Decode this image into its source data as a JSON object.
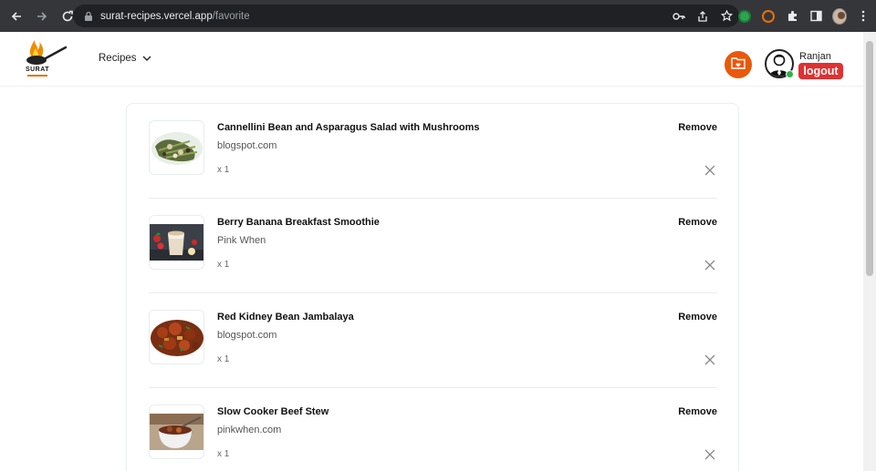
{
  "browser": {
    "url_host": "surat-recipes.vercel.app",
    "url_path": "/favorite"
  },
  "header": {
    "logo_text": "SURAT",
    "nav_label": "Recipes",
    "user_name": "Ranjan",
    "logout_label": "logout"
  },
  "favorites": [
    {
      "title": "Cannellini Bean and Asparagus Salad with Mushrooms",
      "source": "blogspot.com",
      "qty": "x 1",
      "remove_label": "Remove"
    },
    {
      "title": "Berry Banana Breakfast Smoothie",
      "source": "Pink When",
      "qty": "x 1",
      "remove_label": "Remove"
    },
    {
      "title": "Red Kidney Bean Jambalaya",
      "source": "blogspot.com",
      "qty": "x 1",
      "remove_label": "Remove"
    },
    {
      "title": "Slow Cooker Beef Stew",
      "source": "pinkwhen.com",
      "qty": "x 1",
      "remove_label": "Remove"
    }
  ],
  "colors": {
    "accent": "#e8590c",
    "logout": "#e03131",
    "online": "#2fb344"
  }
}
